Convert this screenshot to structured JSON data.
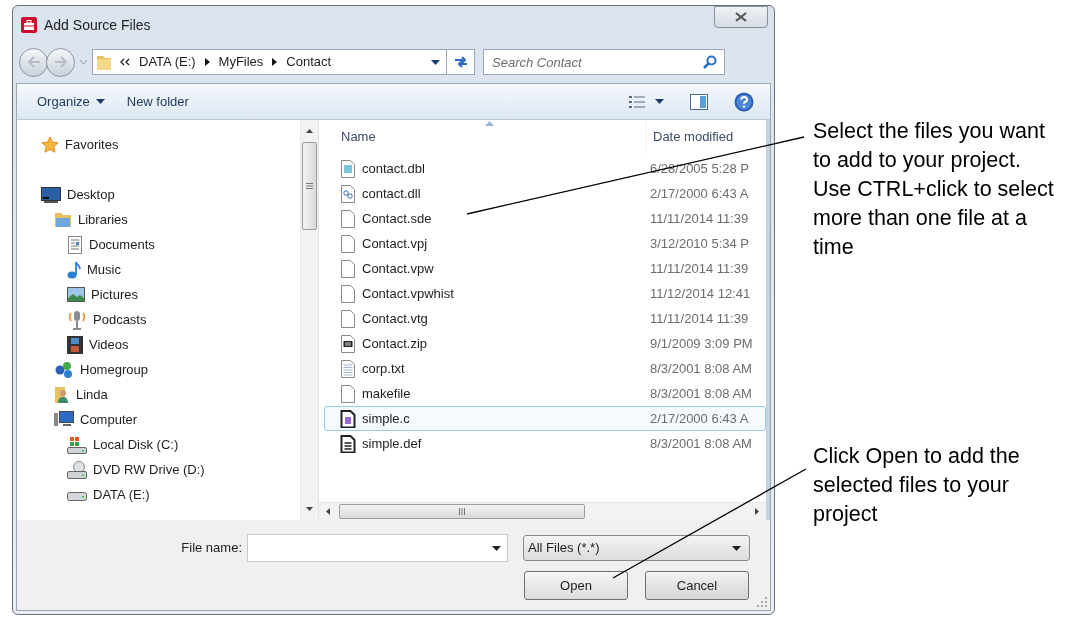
{
  "window": {
    "title": "Add Source Files"
  },
  "address_bar": {
    "path": [
      "DATA (E:)",
      "MyFiles",
      "Contact"
    ]
  },
  "search": {
    "placeholder": "Search Contact"
  },
  "toolbar": {
    "items": [
      {
        "label": "Organize",
        "dropdown": true
      },
      {
        "label": "New folder",
        "dropdown": false
      }
    ]
  },
  "navigation": {
    "items": [
      {
        "label": "Favorites",
        "kind": "star"
      },
      {
        "label": "Desktop",
        "kind": "desktop",
        "children": [
          {
            "label": "Libraries",
            "kind": "library",
            "children": [
              {
                "label": "Documents",
                "kind": "document"
              },
              {
                "label": "Music",
                "kind": "music"
              },
              {
                "label": "Pictures",
                "kind": "pictures"
              },
              {
                "label": "Podcasts",
                "kind": "podcast"
              },
              {
                "label": "Videos",
                "kind": "video"
              }
            ]
          },
          {
            "label": "Homegroup",
            "kind": "homegroup"
          },
          {
            "label": "Linda",
            "kind": "user"
          },
          {
            "label": "Computer",
            "kind": "computer",
            "children": [
              {
                "label": "Local Disk (C:)",
                "kind": "disk"
              },
              {
                "label": "DVD RW Drive (D:)",
                "kind": "dvd"
              },
              {
                "label": "DATA (E:)",
                "kind": "drive"
              }
            ]
          }
        ]
      }
    ]
  },
  "file_list": {
    "columns": [
      "Name",
      "Date modified"
    ],
    "rows": [
      {
        "name": "contact.dbl",
        "date": "6/28/2005 5:28 P",
        "kind": "data",
        "selected": false
      },
      {
        "name": "contact.dll",
        "date": "2/17/2000 6:43 A",
        "kind": "dll",
        "selected": false
      },
      {
        "name": "Contact.sde",
        "date": "11/11/2014 11:39",
        "kind": "blank",
        "selected": false
      },
      {
        "name": "Contact.vpj",
        "date": "3/12/2010 5:34 P",
        "kind": "blank",
        "selected": false
      },
      {
        "name": "Contact.vpw",
        "date": "11/11/2014 11:39",
        "kind": "blank",
        "selected": false
      },
      {
        "name": "Contact.vpwhist",
        "date": "11/12/2014 12:41",
        "kind": "blank",
        "selected": false
      },
      {
        "name": "Contact.vtg",
        "date": "11/11/2014 11:39",
        "kind": "blank",
        "selected": false
      },
      {
        "name": "Contact.zip",
        "date": "9/1/2009 3:09 PM",
        "kind": "zip",
        "selected": false
      },
      {
        "name": "corp.txt",
        "date": "8/3/2001 8:08 AM",
        "kind": "text",
        "selected": false
      },
      {
        "name": "makefile",
        "date": "8/3/2001 8:08 AM",
        "kind": "blank",
        "selected": false
      },
      {
        "name": "simple.c",
        "date": "2/17/2000 6:43 A",
        "kind": "source",
        "selected": true
      },
      {
        "name": "simple.def",
        "date": "8/3/2001 8:08 AM",
        "kind": "def",
        "selected": false
      }
    ]
  },
  "file_name": {
    "label": "File name:"
  },
  "file_type": {
    "value": "All Files (*.*)"
  },
  "buttons": [
    "Open",
    "Cancel"
  ],
  "callouts": [
    "Select the files you want to add to your project. Use CTRL+click to select more than one file at a time",
    "Click Open to add the selected files to your project"
  ]
}
